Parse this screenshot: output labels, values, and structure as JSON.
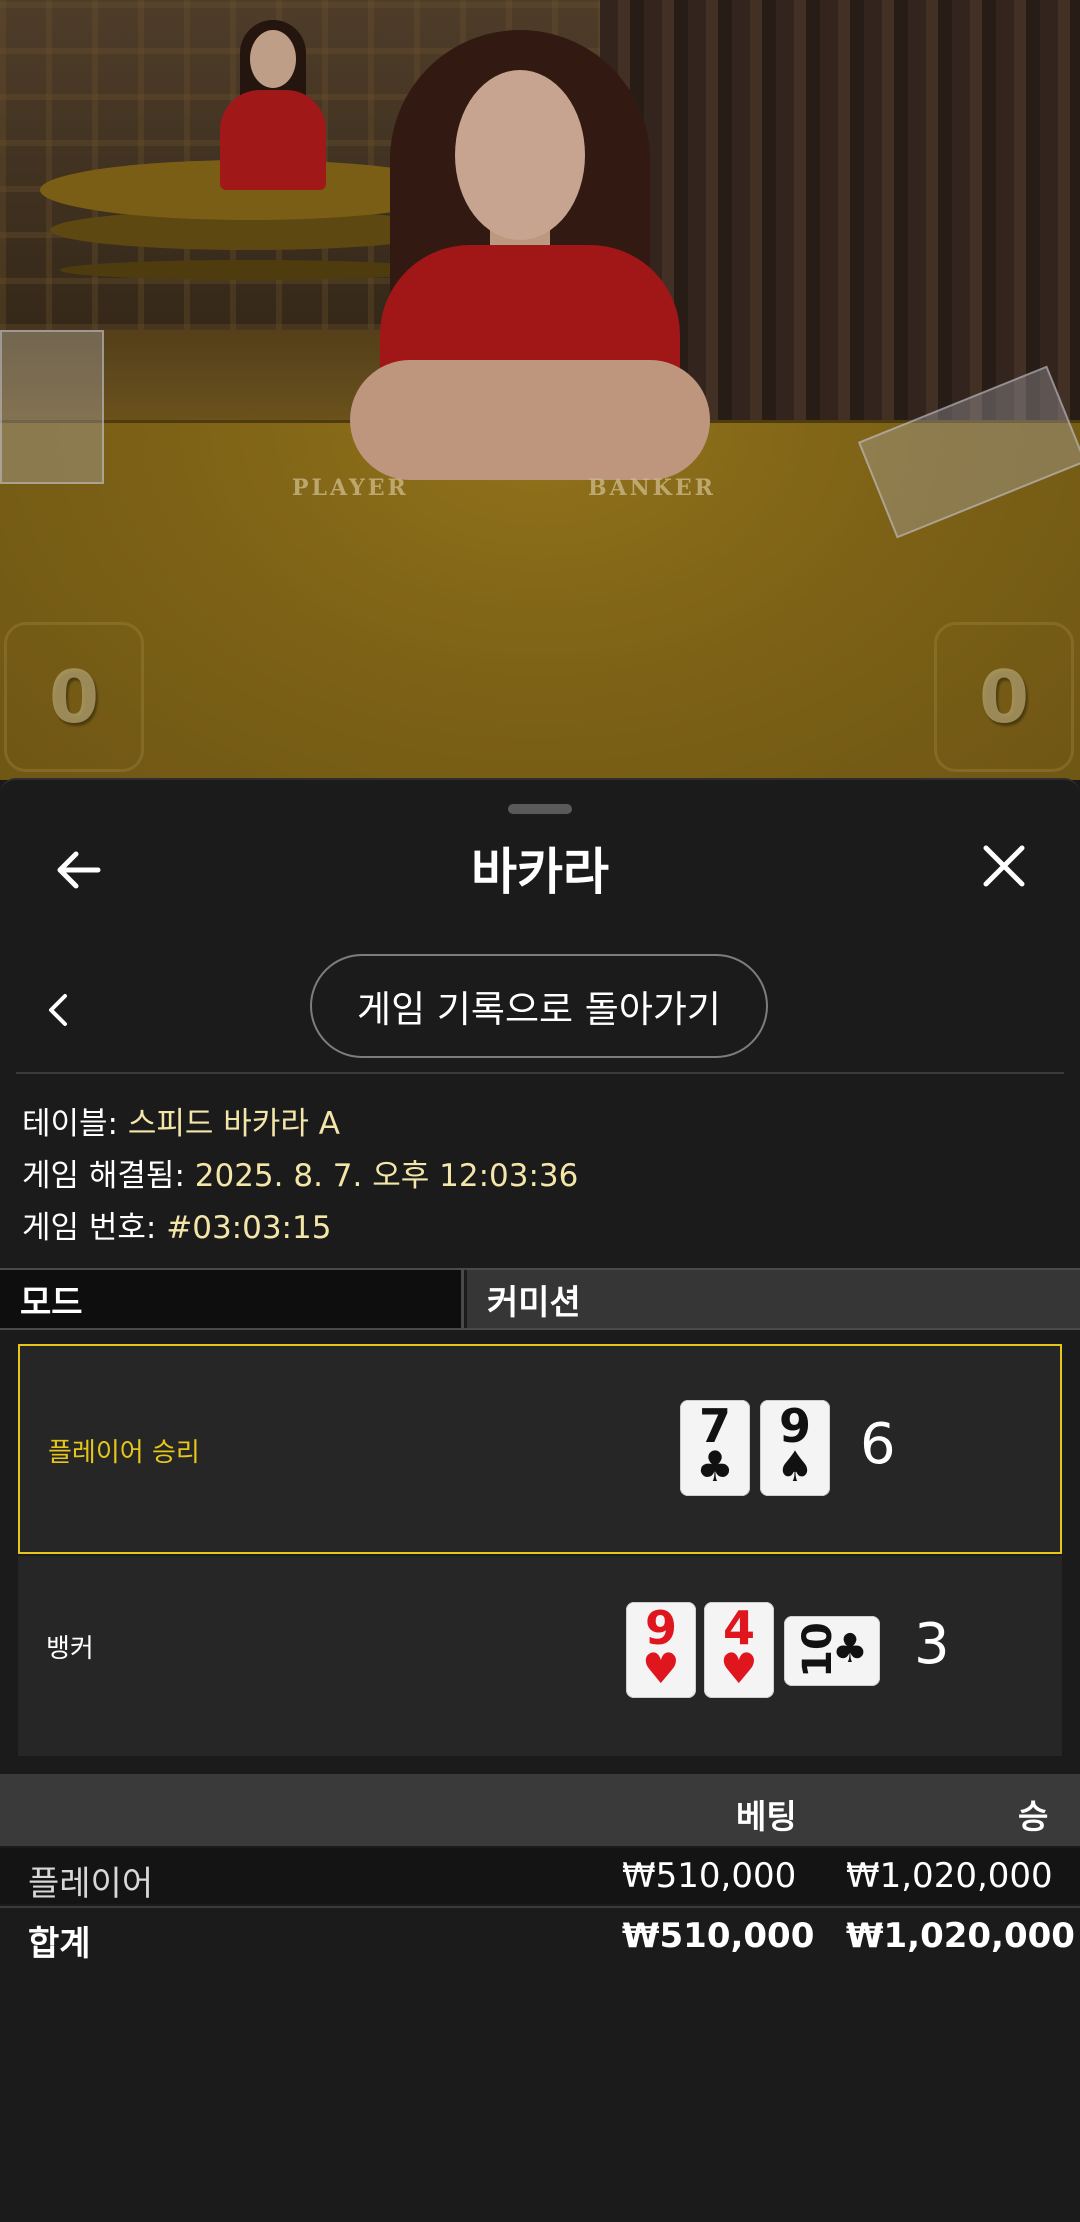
{
  "video": {
    "felt_player": "PLAYER",
    "felt_banker": "BANKER",
    "player_score": "0",
    "banker_score": "0"
  },
  "header": {
    "title": "바카라",
    "back_icon": "arrow-left-icon",
    "close_icon": "close-icon"
  },
  "history_nav": {
    "prev_icon": "chevron-left-icon",
    "return_label": "게임 기록으로 돌아가기"
  },
  "details": {
    "table_label": "테이블:",
    "table_value": "스피드 바카라 A",
    "resolved_label": "게임 해결됨:",
    "resolved_value": "2025. 8. 7. 오후 12:03:36",
    "game_no_label": "게임 번호:",
    "game_no_value": "#03:03:15"
  },
  "mode": {
    "label": "모드",
    "value": "커미션"
  },
  "hands": {
    "player": {
      "label": "플레이어 승리",
      "total": "6",
      "cards": [
        {
          "rank": "7",
          "suit": "♣"
        },
        {
          "rank": "9",
          "suit": "♠"
        }
      ]
    },
    "banker": {
      "label": "뱅커",
      "total": "3",
      "cards": [
        {
          "rank": "9",
          "suit": "♥"
        },
        {
          "rank": "4",
          "suit": "♥"
        },
        {
          "rank": "10",
          "suit": "♣"
        }
      ]
    }
  },
  "bets": {
    "header_bet": "베팅",
    "header_win": "승",
    "rows": [
      {
        "name": "플레이어",
        "bet": "₩510,000",
        "win": "₩1,020,000"
      }
    ],
    "total": {
      "name": "합계",
      "bet": "₩510,000",
      "win": "₩1,020,000"
    }
  },
  "colors": {
    "accent_gold": "#e6c61a",
    "value_cream": "#f3e6a8",
    "card_red": "#e0161e"
  }
}
